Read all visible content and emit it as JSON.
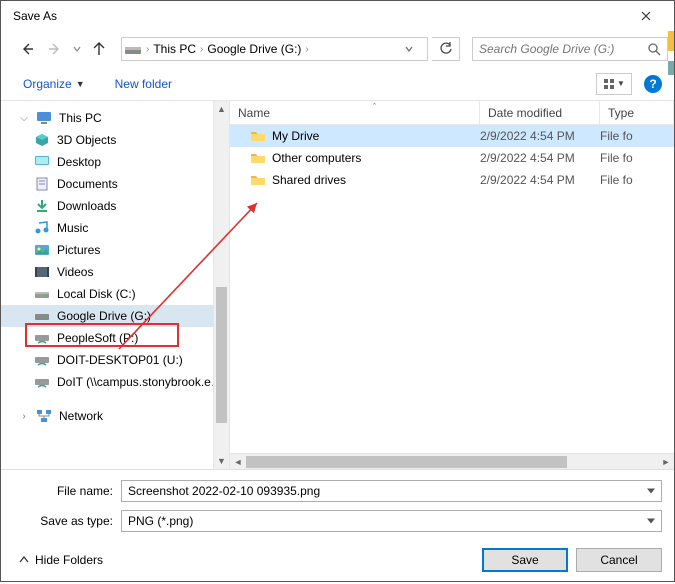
{
  "title": "Save As",
  "breadcrumbs": [
    "This PC",
    "Google Drive (G:)"
  ],
  "search_placeholder": "Search Google Drive (G:)",
  "toolbar": {
    "organize": "Organize",
    "new_folder": "New folder"
  },
  "columns": {
    "name": "Name",
    "date": "Date modified",
    "type": "Type"
  },
  "tree": [
    {
      "label": "This PC",
      "icon": "pc",
      "exp": "v",
      "depth": 0
    },
    {
      "label": "3D Objects",
      "icon": "3d",
      "depth": 1
    },
    {
      "label": "Desktop",
      "icon": "desktop",
      "depth": 1
    },
    {
      "label": "Documents",
      "icon": "docs",
      "depth": 1
    },
    {
      "label": "Downloads",
      "icon": "down",
      "depth": 1
    },
    {
      "label": "Music",
      "icon": "music",
      "depth": 1
    },
    {
      "label": "Pictures",
      "icon": "pics",
      "depth": 1
    },
    {
      "label": "Videos",
      "icon": "video",
      "depth": 1
    },
    {
      "label": "Local Disk (C:)",
      "icon": "disk",
      "depth": 1
    },
    {
      "label": "Google Drive (G:)",
      "icon": "gdrive",
      "depth": 1,
      "selected": true
    },
    {
      "label": "PeopleSoft (P:)",
      "icon": "netdrive",
      "depth": 1
    },
    {
      "label": "DOIT-DESKTOP01 (U:)",
      "icon": "netdrive",
      "depth": 1
    },
    {
      "label": "DoIT (\\\\campus.stonybrook.edu...",
      "icon": "netdrive",
      "depth": 1
    },
    {
      "label": "Network",
      "icon": "network",
      "exp": ">",
      "depth": 0,
      "gap": true
    }
  ],
  "files": [
    {
      "name": "My Drive",
      "date": "2/9/2022 4:54 PM",
      "type": "File fo",
      "selected": true
    },
    {
      "name": "Other computers",
      "date": "2/9/2022 4:54 PM",
      "type": "File fo"
    },
    {
      "name": "Shared drives",
      "date": "2/9/2022 4:54 PM",
      "type": "File fo"
    }
  ],
  "filename_label": "File name:",
  "filename_value": "Screenshot 2022-02-10 093935.png",
  "saveas_label": "Save as type:",
  "saveas_value": "PNG (*.png)",
  "hide_folders": "Hide Folders",
  "buttons": {
    "save": "Save",
    "cancel": "Cancel"
  }
}
